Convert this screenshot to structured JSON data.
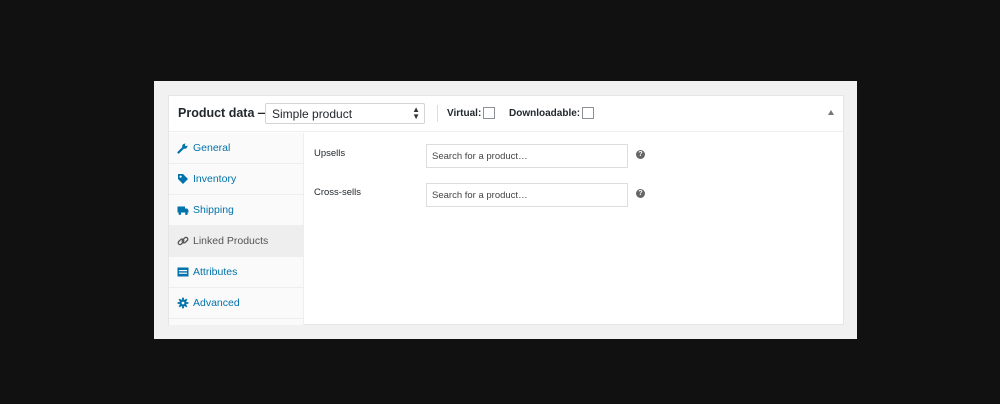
{
  "header": {
    "title": "Product data —",
    "product_type": "Simple product",
    "virtual_label": "Virtual:",
    "downloadable_label": "Downloadable:",
    "virtual_checked": false,
    "downloadable_checked": false
  },
  "tabs": [
    {
      "label": "General",
      "icon": "wrench-icon",
      "active": false
    },
    {
      "label": "Inventory",
      "icon": "tag-icon",
      "active": false
    },
    {
      "label": "Shipping",
      "icon": "truck-icon",
      "active": false
    },
    {
      "label": "Linked Products",
      "icon": "link-icon",
      "active": true
    },
    {
      "label": "Attributes",
      "icon": "list-icon",
      "active": false
    },
    {
      "label": "Advanced",
      "icon": "gear-icon",
      "active": false
    }
  ],
  "fields": {
    "upsells": {
      "label": "Upsells",
      "placeholder": "Search for a product…"
    },
    "cross_sells": {
      "label": "Cross-sells",
      "placeholder": "Search for a product…"
    },
    "help_glyph": "?"
  },
  "colors": {
    "link": "#0073aa",
    "active_tab": "#eeeeee",
    "background": "#111111"
  }
}
